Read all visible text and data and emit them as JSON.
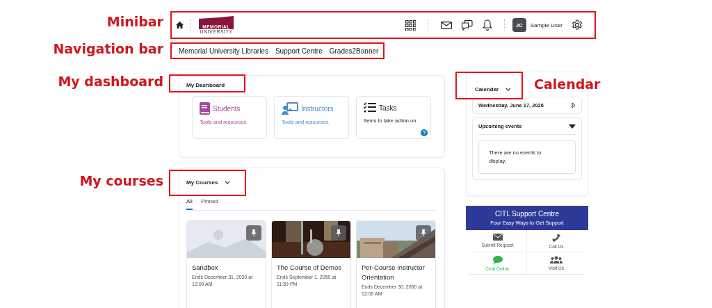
{
  "annotations": [
    {
      "label": "Minibar"
    },
    {
      "label": "Navigation bar"
    },
    {
      "label": "My dashboard"
    },
    {
      "label": "Calendar"
    },
    {
      "label": "My courses"
    }
  ],
  "minibar": {
    "logo_top": "MEMORIAL",
    "logo_bottom": "UNIVERSITY",
    "avatar": "JC",
    "user": "Sample User"
  },
  "navigation": [
    "Memorial University Libraries",
    "Support Centre",
    "Grades2Banner"
  ],
  "dashboard": {
    "title": "My Dashboard",
    "tiles": [
      {
        "kind": "book",
        "title": "Students",
        "text": "Tools and resources.",
        "color": "#a8489e",
        "help": false
      },
      {
        "kind": "teacher",
        "title": "Instructors",
        "text": "Tools and resources.",
        "color": "#4a8ad0",
        "help": false
      },
      {
        "kind": "tasks",
        "title": "Tasks",
        "text": "Items to take action on.",
        "color": "#202122",
        "help": true
      }
    ]
  },
  "courses": {
    "title": "My Courses",
    "tabs": [
      {
        "label": "All",
        "selected": true
      },
      {
        "label": "Pinned",
        "selected": false
      }
    ],
    "cards": [
      {
        "kind": "placeholder",
        "name": "Sandbox",
        "ends": "Ends December 31, 2030 at 12:00 AM"
      },
      {
        "kind": "picture",
        "name": "The Course of Demos",
        "ends": "Ends September 1, 2050 at 11:59 PM"
      },
      {
        "kind": "picture",
        "name": "Per-Course Instructor Orientation",
        "ends": "Ends December 30, 2050 at 12:00 AM"
      }
    ]
  },
  "calendar": {
    "title": "Calendar",
    "date": "Wednesday, June 17, 2026",
    "upcoming": "Upcoming events",
    "empty": "There are no events to display."
  },
  "support": {
    "title": "CITL Support Centre",
    "subtitle": "Four Easy Ways to Get Support",
    "items": [
      {
        "kind": "envelope",
        "label": "Submit Request",
        "color": "#555555"
      },
      {
        "kind": "phone",
        "label": "Call Us",
        "color": "#555555"
      },
      {
        "kind": "chat",
        "label": "Chat Online",
        "color": "#2fb34a"
      },
      {
        "kind": "people",
        "label": "Visit Us",
        "color": "#555555"
      }
    ]
  }
}
